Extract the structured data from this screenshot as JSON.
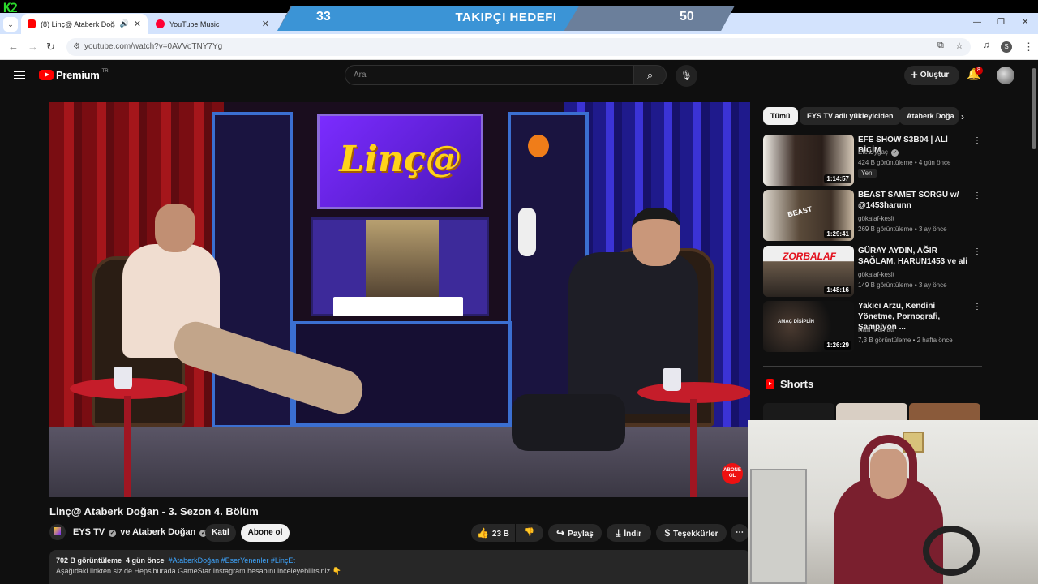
{
  "overlay": {
    "follower_goal": {
      "title": "TAKIPÇI HEDEFI",
      "current": "33",
      "target": "50",
      "progress": 0.66
    },
    "stream_logo": "K2"
  },
  "browser": {
    "tabs": [
      {
        "title": "(8) Linç@ Ataberk Doğan -",
        "active": true,
        "favicon_color": "#ff0000",
        "audio_icon": "speaker-icon"
      },
      {
        "title": "YouTube Music",
        "active": false,
        "favicon_color": "#ff0033"
      }
    ],
    "url": "youtube.com/watch?v=0AVVoTNY7Yg",
    "profile_initial": "S"
  },
  "header": {
    "logo_text": "Premium",
    "logo_sup": "TR",
    "search_placeholder": "Ara",
    "create_label": "Oluştur",
    "notification_count": "8"
  },
  "video": {
    "sign_text": "Linç@",
    "title": "Linç@ Ataberk Doğan - 3. Sezon 4. Bölüm",
    "channel": "EYS TV",
    "channel_join": "ve",
    "channel2": "Ataberk Doğan",
    "join_label": "Katıl",
    "subscribe_label": "Abone ol",
    "likes": "23 B",
    "share_label": "Paylaş",
    "download_label": "İndir",
    "thanks_label": "Teşekkürler",
    "overlay_subscribe": "ABONE OL",
    "description": {
      "views": "702 B görüntüleme",
      "age": "4 gün önce",
      "tags": "#AtaberkDoğan #EserYenenler #LinçEt",
      "line2": "Aşağıdaki linkten siz de Hepsiburada GameStar Instagram hesabını inceleyebilirsiniz 👇"
    }
  },
  "sidebar": {
    "chips": [
      "Tümü",
      "EYS TV adlı yükleyiciden",
      "Ataberk Doğa"
    ],
    "recommendations": [
      {
        "title": "EFE SHOW S3B04 | ALİ BİÇİM",
        "channel": "Efe Uygaç",
        "verified": true,
        "meta": "424 B görüntüleme • 4 gün önce",
        "duration": "1:14:57",
        "badge": "Yeni",
        "thumb_color": "#3a2b24"
      },
      {
        "title": "BEAST SAMET SORGU w/ @1453harunn",
        "channel": "gökalaf-keslt",
        "verified": false,
        "meta": "269 B görüntüleme • 3 ay önce",
        "duration": "1:29:41",
        "badge": "",
        "thumb_color": "#5a4a3a"
      },
      {
        "title": "GÜRAY AYDIN, AĞIR SAĞLAM, HARUN1453 ve ali",
        "channel": "gökalaf-keslt",
        "verified": false,
        "meta": "149 B görüntüleme • 3 ay önce",
        "duration": "1:48:16",
        "badge": "",
        "thumb_color": "#6a2a2a",
        "thumb_text": "ZORBALAF"
      },
      {
        "title": "Yakıcı Arzu, Kendini Yönetme, Pornografi, Şampiyon ...",
        "channel": "Halil Mamati",
        "verified": false,
        "meta": "7,3 B görüntüleme • 2 hafta önce",
        "duration": "1:26:29",
        "badge": "",
        "thumb_color": "#1a1a1a",
        "thumb_text": "AMAÇ DİSİPLİN"
      }
    ],
    "shorts_title": "Shorts"
  }
}
